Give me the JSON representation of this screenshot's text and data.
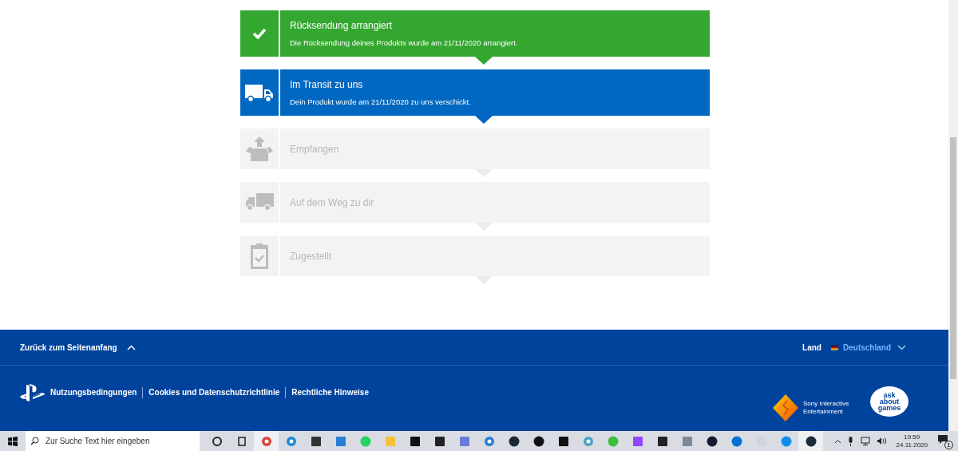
{
  "steps": [
    {
      "title": "Rücksendung arrangiert",
      "description": "Die Rücksendung deines Produkts wurde am 21/11/2020 arrangiert.",
      "kind": "done"
    },
    {
      "title": "Im Transit zu uns",
      "description": "Dein Produkt wurde am 21/11/2020 zu uns verschickt.",
      "kind": "current"
    },
    {
      "title": "Empfangen",
      "kind": "pending"
    },
    {
      "title": "Auf dem Weg zu dir",
      "kind": "pending"
    },
    {
      "title": "Zugestellt",
      "kind": "pending"
    }
  ],
  "footer": {
    "back_to_top": "Zurück zum Seitenanfang",
    "country_label": "Land",
    "country": "Deutschland",
    "links": [
      "Nutzungsbedingungen",
      "Cookies und Datenschutzrichtlinie",
      "Rechtliche Hinweise"
    ],
    "sony_text": "Sony Interactive Entertainment",
    "ask_about_games": "ask about games"
  },
  "taskbar": {
    "search": {
      "placeholder": "Zur Suche Text hier eingeben"
    },
    "time": "19:59",
    "date": "24.11.2020",
    "notification_count": "1"
  }
}
